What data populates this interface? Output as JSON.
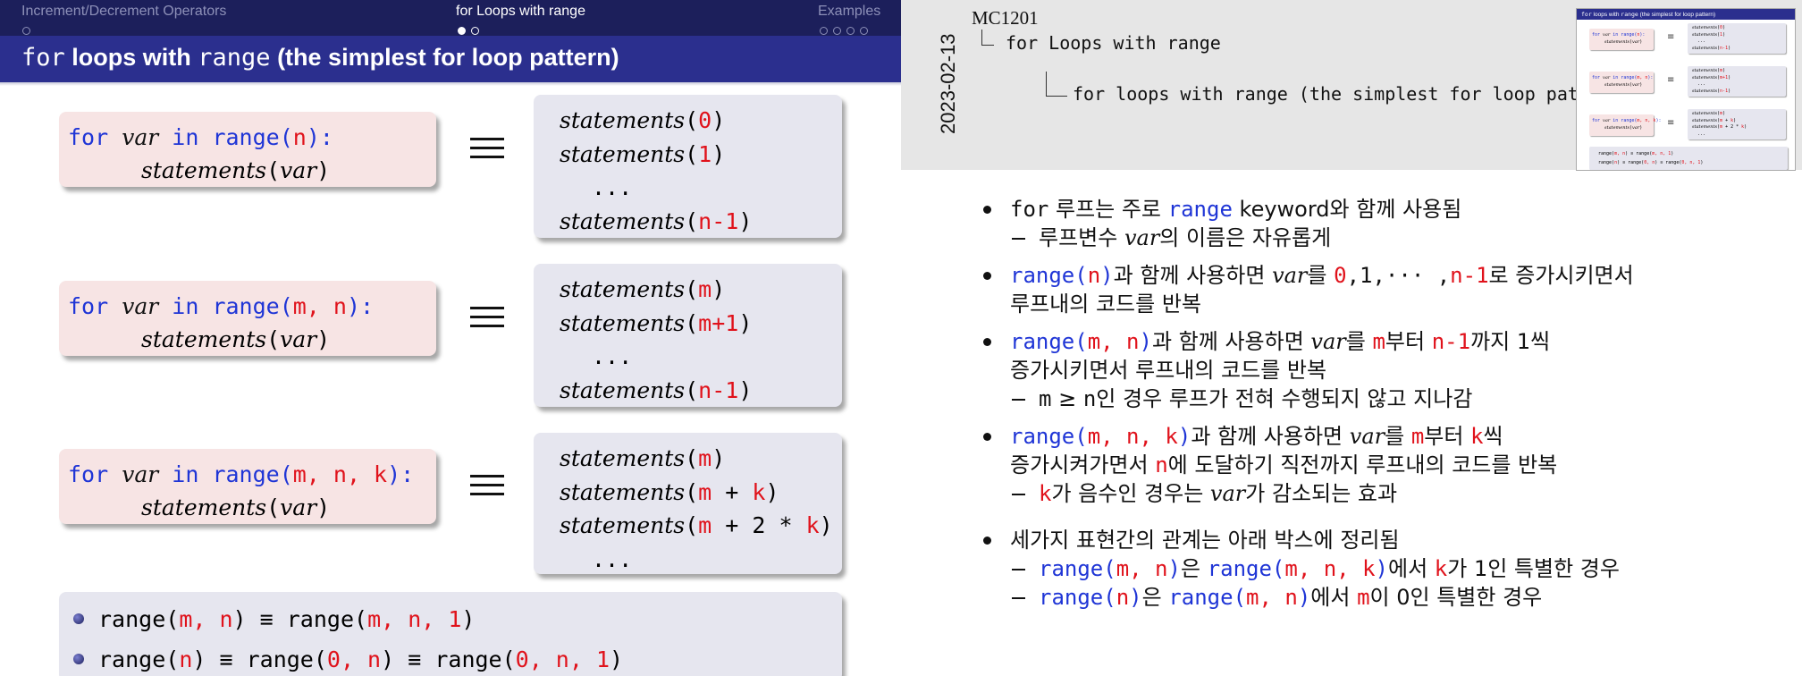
{
  "slide": {
    "nav": {
      "sec1": "Increment/Decrement Operators",
      "sec2": "for Loops with range",
      "sec3": "Examples"
    },
    "title": {
      "kw_for": "for",
      "t1": " loops with ",
      "kw_range": "range",
      "t2": "  (the simplest for loop pattern)"
    },
    "rows": [
      {
        "code": {
          "for": "for",
          "var": "var",
          "in": "in",
          "range_open": "range(",
          "args": "n",
          "close": "):"
        },
        "body": {
          "stmt": "statements",
          "arg": "var"
        },
        "expansion": [
          {
            "f": "statements",
            "a": "0"
          },
          {
            "f": "statements",
            "a": "1"
          },
          {
            "dots": "..."
          },
          {
            "f": "statements",
            "a": "n-1"
          }
        ]
      },
      {
        "code": {
          "for": "for",
          "var": "var",
          "in": "in",
          "range_open": "range(",
          "args": "m, n",
          "close": "):"
        },
        "body": {
          "stmt": "statements",
          "arg": "var"
        },
        "expansion": [
          {
            "f": "statements",
            "a": "m"
          },
          {
            "f": "statements",
            "a": "m+1"
          },
          {
            "dots": "..."
          },
          {
            "f": "statements",
            "a": "n-1"
          }
        ]
      },
      {
        "code": {
          "for": "for",
          "var": "var",
          "in": "in",
          "range_open": "range(",
          "args": "m, n, k",
          "close": "):"
        },
        "body": {
          "stmt": "statements",
          "arg": "var"
        },
        "expansion": [
          {
            "f": "statements",
            "a": "m"
          },
          {
            "f": "statements",
            "a1": "m",
            "op": " + ",
            "a2": "k"
          },
          {
            "f": "statements",
            "a1": "m",
            "op": " + 2 * ",
            "a2": "k"
          },
          {
            "dots": "..."
          }
        ]
      }
    ],
    "bottom": {
      "b1": {
        "r": "range(",
        "a1": "m, n",
        "c": ")",
        "eq": " ≡ ",
        "r2": "range(",
        "a2": "m, n, 1",
        "c2": ")"
      },
      "b2": {
        "r": "range(",
        "a1": "n",
        "c": ")",
        "eq": " ≡ ",
        "r2": "range(",
        "a2": "0, n",
        "c2": ")",
        "eq2": " ≡ ",
        "r3": "range(",
        "a3": "0, n, 1",
        "c3": ")"
      }
    }
  },
  "notes": {
    "date": "2023-02-13",
    "course": "MC1201",
    "section": "for Loops with range",
    "subsection": "for loops with range  (the simplest for loop pattern)",
    "items": [
      {
        "p1": "for",
        "p2": " 루프는 주로 ",
        "p3": "range",
        "p4": " keyword와 함께 사용됨"
      },
      {
        "p1": "루프변수 ",
        "p2": "var",
        "p3": "의 이름은 자유롭게"
      },
      {
        "p1": "range(",
        "p2": "n",
        "p3": ")",
        "p4": "과 함께 사용하면 ",
        "p5": "var",
        "p6": "를 ",
        "p7": "0",
        "p8": ",1,··· ,",
        "p9": "n-1",
        "p10": "로 증가시키면서",
        "p11": "루프내의 코드를 반복"
      },
      {
        "p1": "range(",
        "p2": "m, n",
        "p3": ")",
        "p4": "과 함께 사용하면 ",
        "p5": "var",
        "p6": "를 ",
        "p7": "m",
        "p8": "부터 ",
        "p9": "n-1",
        "p10": "까지 1씩",
        "p11": "증가시키면서 루프내의 코드를 반복"
      },
      {
        "p1": "m",
        "p2": " ≥ ",
        "p3": "n",
        "p4": "인 경우 루프가 전혀 수행되지 않고 지나감"
      },
      {
        "p1": "range(",
        "p2": "m, n, k",
        "p3": ")",
        "p4": "과 함께 사용하면 ",
        "p5": "var",
        "p6": "를 ",
        "p7": "m",
        "p8": "부터 ",
        "p9": "k",
        "p10": "씩",
        "p11": "증가시켜가면서 ",
        "p12": "n",
        "p13": "에 도달하기 직전까지 루프내의 코드를 반복"
      },
      {
        "p1": "k",
        "p2": "가 음수인 경우는 ",
        "p3": "var",
        "p4": "가 감소되는 효과"
      },
      {
        "p1": "세가지 표현간의 관계는 아래 박스에 정리됨"
      },
      {
        "p1": "range(",
        "p2": "m, n",
        "p3": ")",
        "p4": "은 ",
        "p5": "range(",
        "p6": "m, n, k",
        "p7": ")",
        "p8": "에서 ",
        "p9": "k",
        "p10": "가 1인 특별한 경우"
      },
      {
        "p1": "range(",
        "p2": "n",
        "p3": ")",
        "p4": "은 ",
        "p5": "range(",
        "p6": "m, n",
        "p7": ")",
        "p8": "에서 ",
        "p9": "m",
        "p10": "이 0인 특별한 경우"
      }
    ]
  }
}
